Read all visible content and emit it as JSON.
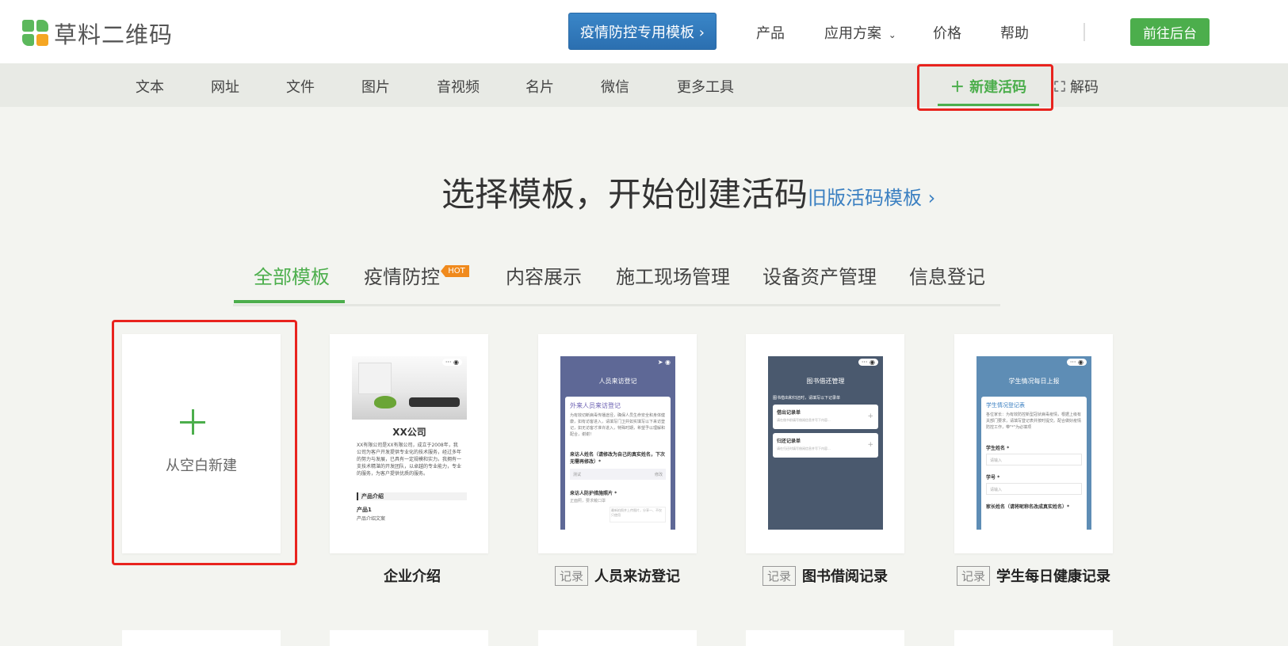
{
  "header": {
    "logo_text": "草料二维码",
    "promo_label": "疫情防控专用模板 ›",
    "nav": [
      "产品",
      "应用方案",
      "价格",
      "帮助"
    ],
    "backend_label": "前往后台"
  },
  "toolbar": {
    "items": [
      "文本",
      "网址",
      "文件",
      "图片",
      "音视频",
      "名片",
      "微信",
      "更多工具"
    ],
    "new_live_label": "＋ 新建活码",
    "decode_label": "解码"
  },
  "hero": {
    "title": "选择模板，开始创建活码",
    "old_link": "旧版活码模板 ›"
  },
  "tabs": {
    "items": [
      "全部模板",
      "疫情防控",
      "内容展示",
      "施工现场管理",
      "设备资产管理",
      "信息登记"
    ],
    "hot_badge": "HOT",
    "active_index": 0
  },
  "cards": {
    "blank_label": "从空白新建",
    "tag": "记录",
    "names": [
      "企业介绍",
      "人员来访登记",
      "图书借阅记录",
      "学生每日健康记录"
    ],
    "company": {
      "title": "XX公司",
      "intro": "XX有限公司是XX有限公司，成立于2008年，我公司为客户开发提供专业化的技术服务，经过多年的努力与发展，已具有一定规模和实力。我拥有一支技术精湛的开发团队，以卓越的专业能力，专业的服务，为客户提供优质的服务。",
      "section": "产品介绍",
      "product": "产品1",
      "product_desc": "产品介绍文案"
    },
    "visitor": {
      "header": "人员来访登记",
      "form_title": "外来人员来访登记",
      "desc": "为有效切断病毒传播途径，确保人员生命安全和身体健康，如有访客进入，请填写门卫并如实填写以下来访登记，如无访客才准许进入，特殊时期，希望予以理解和配合，谢谢！",
      "q1": "来访人姓名（请修改为自己的真实姓名，下次无需再修改）*",
      "q1_value": "测试",
      "q1_action": "修改",
      "q2": "来访人防护措施照片 *",
      "q2_hint": "正面照，要求戴口罩",
      "upload_hint": "最新拍照并上传图片，分享一、不仅只使用"
    },
    "library": {
      "header": "图书借还管理",
      "desc": "图书借出和归还时，请填写以下记录单",
      "r1": "借出记录单",
      "r1_desc": "请在借书前填写借阅信息并写下内容...",
      "r2": "归还记录单",
      "r2_desc": "请在归还时填写借阅信息并写下内容..."
    },
    "student": {
      "header": "学生情况每日上报",
      "form_title": "学生情况登记表",
      "desc": "各位家长：为有效防控新型冠状病毒疫情，根据上级有关部门要求，请填写登记表并按时提交。配合做好疫情防控工作，带\"*\"为必填项",
      "f1": "学生姓名 *",
      "f2": "学号 *",
      "f3": "家长姓名（请将昵称名改成真实姓名）*",
      "placeholder": "请输入"
    }
  },
  "colors": {
    "green": "#4cae4c",
    "blue": "#2b6fb0",
    "link": "#3a7fc1",
    "highlight": "#e8231e",
    "hot": "#f08a1d"
  }
}
